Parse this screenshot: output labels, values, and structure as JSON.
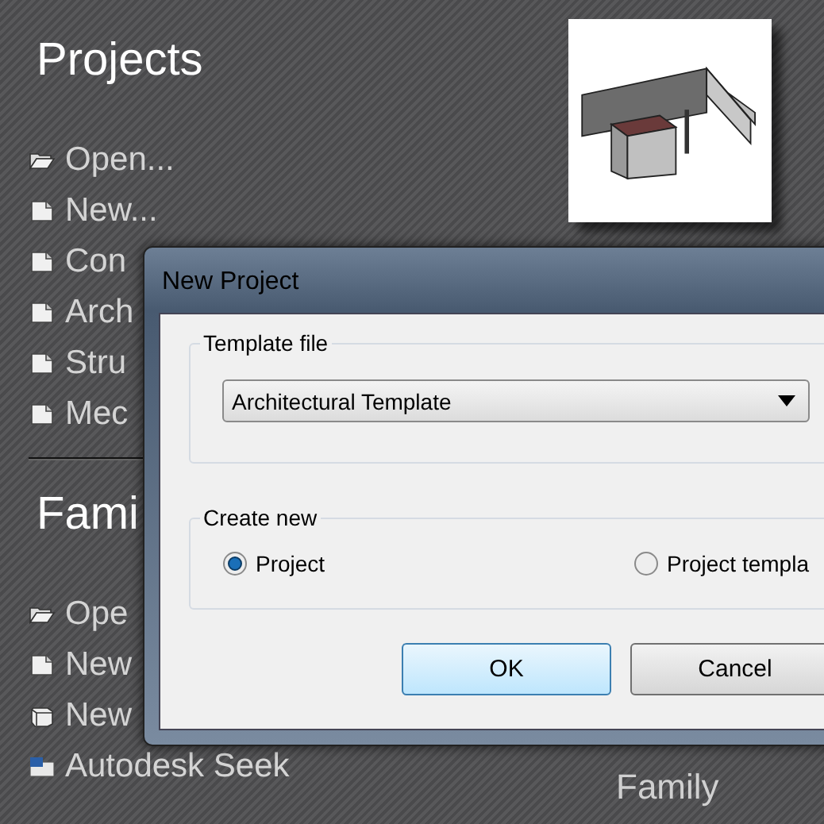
{
  "projects": {
    "title": "Projects",
    "items": [
      {
        "label": "Open...",
        "kind": "folder"
      },
      {
        "label": "New...",
        "kind": "page"
      },
      {
        "label": "Con",
        "kind": "page"
      },
      {
        "label": "Arch",
        "kind": "page"
      },
      {
        "label": "Stru",
        "kind": "page"
      },
      {
        "label": "Mec",
        "kind": "page"
      }
    ]
  },
  "families": {
    "title": "Fami",
    "items": [
      {
        "label": "Ope",
        "kind": "folder"
      },
      {
        "label": "New",
        "kind": "page"
      },
      {
        "label": "New",
        "kind": "cube"
      },
      {
        "label": "Autodesk Seek",
        "kind": "seek"
      }
    ]
  },
  "family_caption": "Family",
  "dialog": {
    "title": "New Project",
    "template_group": {
      "label": "Template file",
      "value": "Architectural Template"
    },
    "create_group": {
      "label": "Create new",
      "options": [
        {
          "label": "Project",
          "selected": true
        },
        {
          "label": "Project templa",
          "selected": false
        }
      ]
    },
    "buttons": [
      {
        "label": "OK",
        "kind": "default"
      },
      {
        "label": "Cancel",
        "kind": "normal"
      }
    ]
  }
}
